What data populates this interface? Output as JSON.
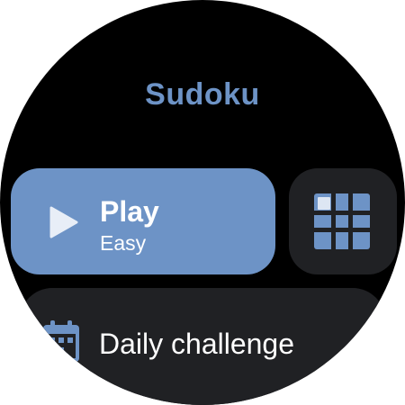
{
  "app": {
    "title": "Sudoku"
  },
  "play": {
    "label": "Play",
    "difficulty": "Easy",
    "icon": "play-icon"
  },
  "grid": {
    "icon": "grid-icon"
  },
  "daily": {
    "label": "Daily challenge",
    "icon": "calendar-icon"
  },
  "colors": {
    "accent": "#6d93c6",
    "surface": "#202124",
    "background": "#000000",
    "text": "#ffffff"
  }
}
